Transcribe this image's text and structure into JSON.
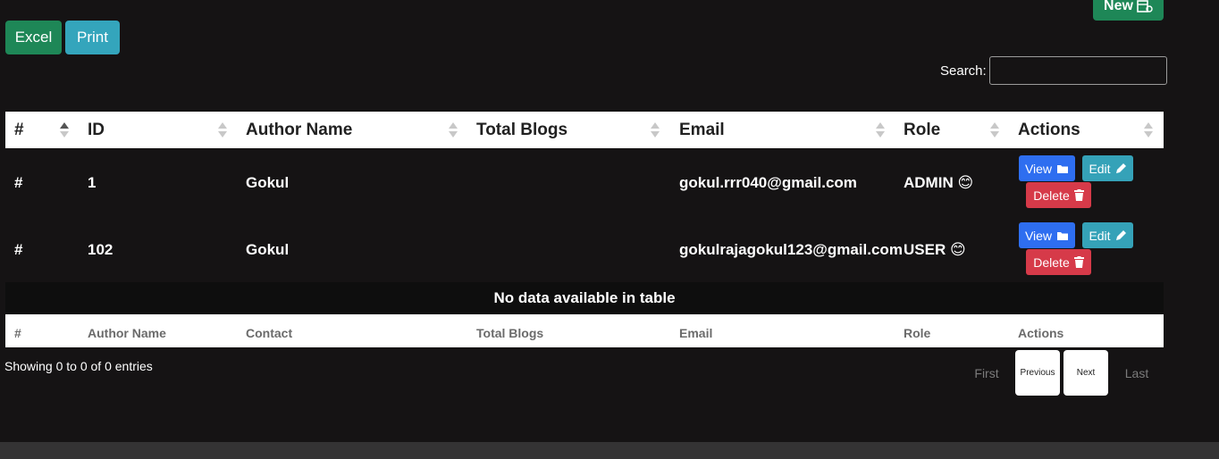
{
  "toolbar": {
    "excel_label": "Excel",
    "print_label": "Print",
    "new_label": "New"
  },
  "search": {
    "label": "Search:",
    "value": "",
    "placeholder": ""
  },
  "table": {
    "headers": [
      "#",
      "ID",
      "Author Name",
      "Total Blogs",
      "Email",
      "Role",
      "Actions"
    ],
    "rows": [
      {
        "hash": "#",
        "id": "1",
        "author": "Gokul",
        "total_blogs": "",
        "email": "gokul.rrr040@gmail.com",
        "role": "ADMIN 😊"
      },
      {
        "hash": "#",
        "id": "102",
        "author": "Gokul",
        "total_blogs": "",
        "email": "gokulrajagokul123@gmail.com",
        "role": "USER 😊"
      }
    ],
    "actions": {
      "view": "View",
      "edit": "Edit",
      "delete": "Delete"
    },
    "empty_message": "No data available in table",
    "footers": [
      "#",
      "Author Name",
      "Contact",
      "Total Blogs",
      "Email",
      "Role",
      "Actions"
    ]
  },
  "info_text": "Showing 0 to 0 of 0 entries",
  "pagination": {
    "first": "First",
    "previous": "Previous",
    "next": "Next",
    "last": "Last"
  },
  "colors": {
    "success": "#1e8757",
    "info": "#35a2b8",
    "primary": "#2e6ef0",
    "danger": "#d63a49",
    "background": "#151314"
  }
}
